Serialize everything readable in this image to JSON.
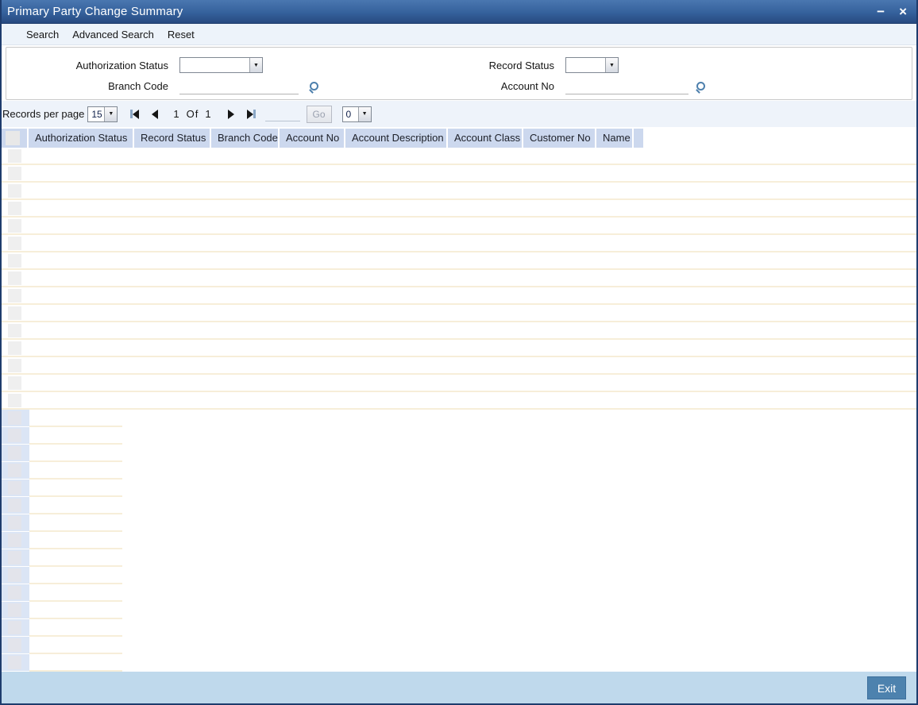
{
  "window": {
    "title": "Primary Party Change Summary",
    "minimize_label": "−",
    "close_label": "×"
  },
  "toolbar": {
    "search_label": "Search",
    "advanced_search_label": "Advanced Search",
    "reset_label": "Reset"
  },
  "filters": {
    "authorization_status": {
      "label": "Authorization Status",
      "value": ""
    },
    "record_status": {
      "label": "Record Status",
      "value": ""
    },
    "branch_code": {
      "label": "Branch Code",
      "value": ""
    },
    "account_no": {
      "label": "Account No",
      "value": ""
    }
  },
  "pagination": {
    "records_per_page_label": "Records per page",
    "records_per_page_value": "15",
    "current_page": "1",
    "of_label": "Of",
    "total_pages": "1",
    "page_input_value": "",
    "go_label": "Go",
    "trailing_select_value": "0"
  },
  "table": {
    "columns": [
      "Authorization Status",
      "Record Status",
      "Branch Code",
      "Account No",
      "Account Description",
      "Account Class",
      "Customer No",
      "Name"
    ],
    "upper_row_count": 15,
    "lower_row_count": 15,
    "rows": []
  },
  "footer": {
    "exit_label": "Exit"
  },
  "colors": {
    "titlebar_top": "#4a77b0",
    "titlebar_bottom": "#284a80",
    "toolbar_bg": "#edf3fa",
    "header_cell_bg": "#ccd8ee",
    "row_separator": "#f7eed9",
    "lower_left_column_bg": "#dbe5f5",
    "footer_band_bg": "#bfd9ec",
    "exit_button_bg": "#4d82ae",
    "window_border": "#1e3c6d"
  }
}
